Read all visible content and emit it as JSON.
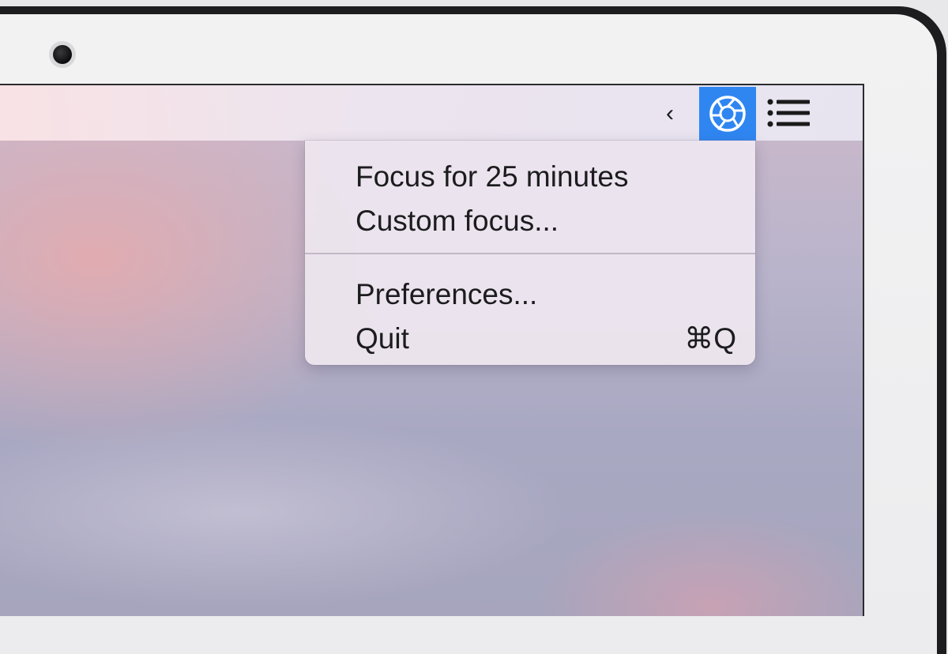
{
  "menubar": {
    "chevron": "‹",
    "app_icon": "focus-shutter-icon",
    "list_icon": "list-icon",
    "accent_color": "#2f86f1"
  },
  "menu": {
    "items": [
      {
        "label": "Focus for 25 minutes",
        "shortcut": ""
      },
      {
        "label": "Custom focus...",
        "shortcut": ""
      },
      {
        "label": "Preferences...",
        "shortcut": ""
      },
      {
        "label": "Quit",
        "shortcut": "⌘Q"
      }
    ]
  }
}
